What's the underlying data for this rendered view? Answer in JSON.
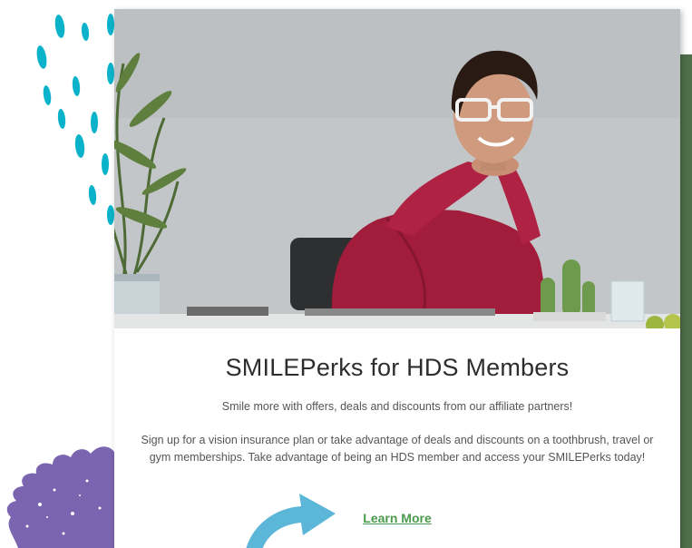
{
  "promo": {
    "title": "SMILEPerks for HDS Members",
    "subtitle": "Smile more with offers, deals and discounts from our affiliate partners!",
    "body": "Sign up for a vision insurance plan or take advantage of deals and discounts on a toothbrush, travel or gym memberships. Take advantage of being an HDS member and access your SMILEPerks today!",
    "cta_label": "Learn More"
  },
  "colors": {
    "accent_teal": "#0ab3c9",
    "accent_purple": "#7b64b0",
    "accent_green": "#4f6e4a",
    "link_green": "#4a9a4c",
    "arrow_blue": "#5bb6d8"
  },
  "icons": {
    "decor_dashes": "teal-dashes-decoration",
    "decor_foliage": "purple-foliage-decoration",
    "arrow": "curved-arrow-icon"
  }
}
